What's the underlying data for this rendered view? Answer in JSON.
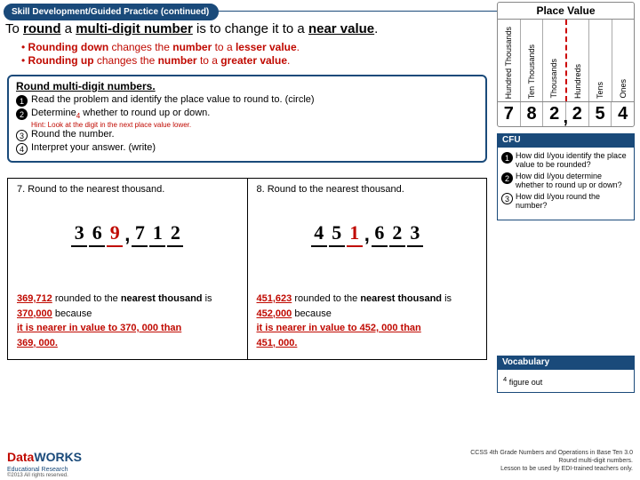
{
  "tab": "Skill Development/Guided Practice (continued)",
  "headline": {
    "p1": "To ",
    "u1": "round",
    "p2": " a ",
    "u2": "multi-digit number",
    "p3": " is to change it to a ",
    "u3": "near value",
    "p4": "."
  },
  "bullets": [
    {
      "pre": "• ",
      "b1": "Rounding down",
      "mid": " changes the  ",
      "b2": "number",
      "mid2": " to a  ",
      "b3": "lesser value",
      "end": "."
    },
    {
      "pre": "• ",
      "b1": "Rounding up",
      "mid": " changes the  ",
      "b2": "number",
      "mid2": " to a  ",
      "b3": "greater value",
      "end": "."
    }
  ],
  "pv": {
    "title": "Place Value",
    "labels": [
      "Hundred Thousands",
      "Ten Thousands",
      "Thousands",
      "Hundreds",
      "Tens",
      "Ones"
    ],
    "digits": [
      "7",
      "8",
      "2",
      "2",
      "5",
      "4"
    ]
  },
  "steps": {
    "title": "Round multi-digit numbers.",
    "s1": "Read the problem and identify the place value to round to.  (circle)",
    "s2a": "Determine",
    "s2sub": "4",
    "s2b": " whether to round up or down.",
    "hint": "Hint: Look at the digit in the next place value lower.",
    "s3": "Round the number.",
    "s4": "Interpret your answer. (write)"
  },
  "cfu": {
    "h": "CFU",
    "q1": "How did I/you identify the place value to be rounded?",
    "q2": "How did I/you determine whether to round up or down?",
    "q3": "How did I/you round the number?"
  },
  "p7": {
    "title": "7.  Round to the nearest thousand.",
    "digits": [
      "3",
      "6",
      "9",
      "7",
      "1",
      "2"
    ],
    "markIndex": 2,
    "a_num": "369,712",
    "a_mid": " rounded to the ",
    "a_b": "nearest thousand",
    "a_is": " is ",
    "a_round": "370,000",
    "a_bec": " because",
    "a_line2": "it is nearer in value to 370, 000 than",
    "a_line3": "369, 000."
  },
  "p8": {
    "title": "8. Round to the nearest thousand.",
    "digits": [
      "4",
      "5",
      "1",
      "6",
      "2",
      "3"
    ],
    "markIndex": 2,
    "a_num": "451,623",
    "a_mid": " rounded to the ",
    "a_b": "nearest thousand",
    "a_is": " is ",
    "a_round": "452,000",
    "a_bec": " because",
    "a_line2": "it is nearer in value to 452, 000 than",
    "a_line3": "451, 000."
  },
  "vocab": {
    "h": "Vocabulary",
    "item": "figure out",
    "sup": "4"
  },
  "footer": {
    "logo1": "Data",
    "logo2": "WORKS",
    "logoSub": "Educational Research",
    "copy": "©2013 All rights reserved.",
    "ccss1": "CCSS 4th Grade Numbers and Operations in Base Ten 3.0",
    "ccss2": "Round multi-digit numbers.",
    "ccss3": "Lesson to be used by EDI-trained teachers only."
  }
}
